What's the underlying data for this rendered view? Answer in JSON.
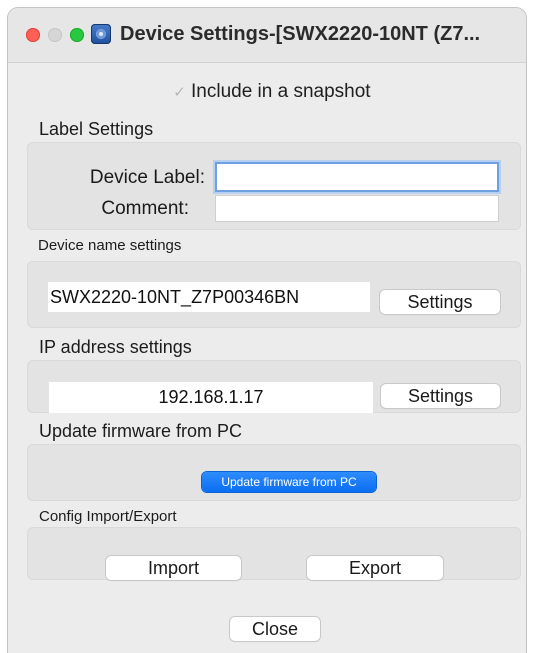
{
  "window": {
    "title": "Device Settings-[SWX2220-10NT (Z7..."
  },
  "snapshot": {
    "label": "Include in a snapshot",
    "checked": true
  },
  "label_settings": {
    "heading": "Label Settings",
    "device_label": "Device Label:",
    "device_label_value": "",
    "comment": "Comment:",
    "comment_value": ""
  },
  "device_name": {
    "heading": "Device name settings",
    "value": "SWX2220-10NT_Z7P00346BN",
    "button": "Settings"
  },
  "ip_settings": {
    "heading": "IP address settings",
    "value": "192.168.1.17",
    "button": "Settings"
  },
  "firmware": {
    "heading": "Update firmware from PC",
    "button": "Update firmware from PC"
  },
  "config": {
    "heading": "Config Import/Export",
    "import_button": "Import",
    "export_button": "Export"
  },
  "footer": {
    "close_button": "Close"
  },
  "colors": {
    "accent": "#0a6ef0",
    "focus_ring": "#6fa0e0"
  }
}
